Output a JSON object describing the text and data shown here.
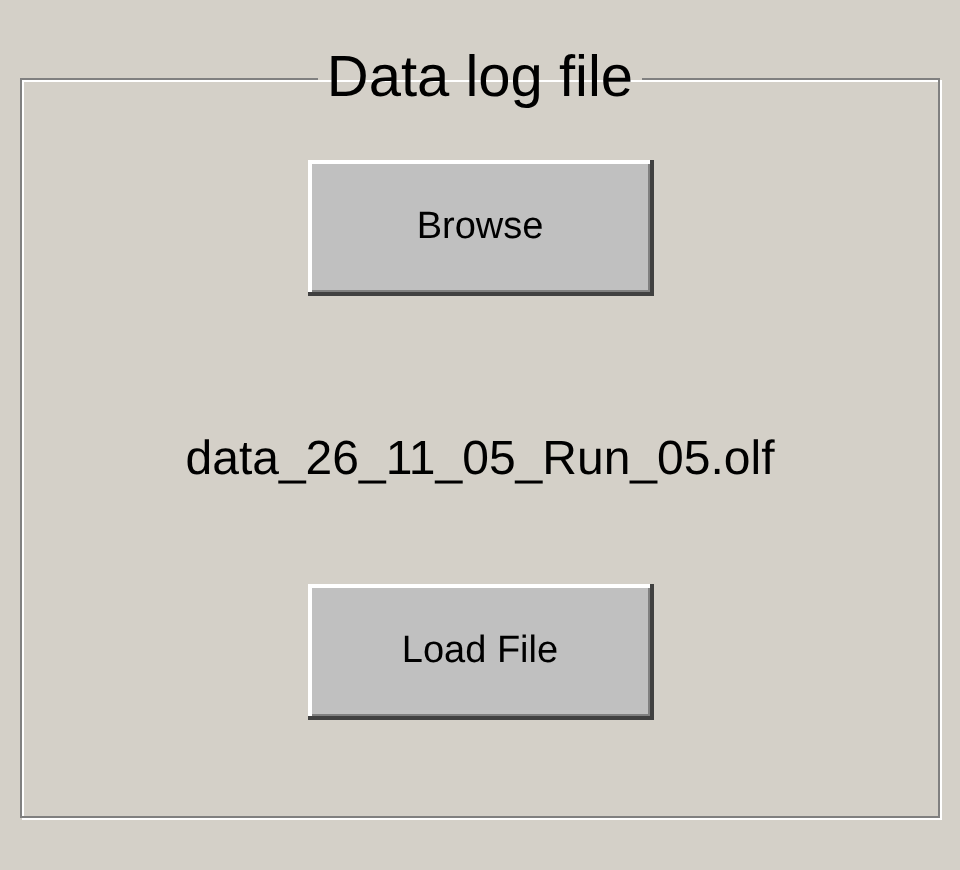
{
  "group": {
    "title": "Data log file"
  },
  "browse_button": {
    "label": "Browse"
  },
  "file_name": "data_26_11_05_Run_05.olf",
  "load_button": {
    "label": "Load File"
  }
}
